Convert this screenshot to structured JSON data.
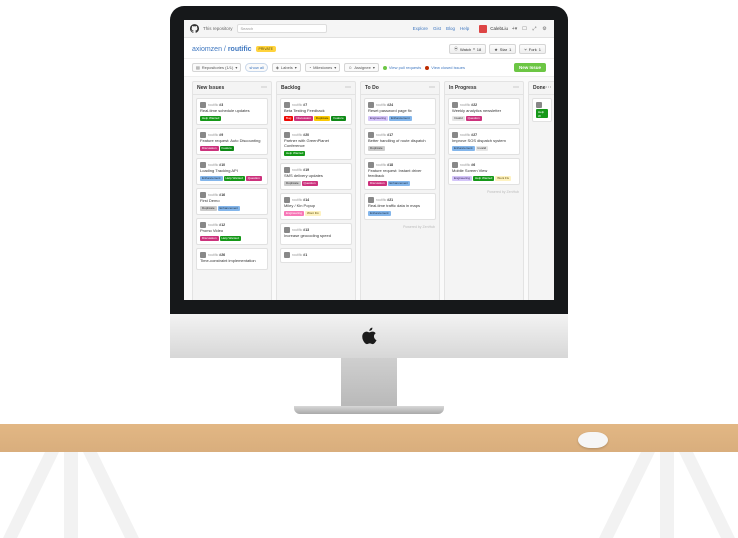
{
  "nav": {
    "context": "This repository",
    "search_placeholder": "Search",
    "links": [
      "Explore",
      "Gist",
      "Blog",
      "Help"
    ],
    "user": "CalebLiu",
    "icons": [
      "plus-icon",
      "notif-icon",
      "expand-icon",
      "gear-icon"
    ]
  },
  "repo": {
    "owner": "axiomzen",
    "name": "routific",
    "badge": "PRIVATE",
    "buttons": {
      "watch": "Watch",
      "star": "Star",
      "fork": "Fork",
      "watch_n": "18",
      "star_n": "1",
      "fork_n": "1"
    }
  },
  "filters": {
    "repos": "Repositories (1/1)",
    "show": "show all",
    "labels": "Labels",
    "milestones": "Milestones",
    "assignee": "Assignee",
    "open": "View pull requests",
    "closed": "View closed issues",
    "new_issue": "New Issue"
  },
  "board": {
    "columns": [
      {
        "title": "New Issues",
        "cards": [
          {
            "ref_repo": "routific",
            "ref_num": "#3",
            "title": "Real-time schedule updates",
            "labels": [
              "Help Wanted"
            ],
            "lcls": [
              "l-help"
            ]
          },
          {
            "ref_repo": "routific",
            "ref_num": "#9",
            "title": "Feature request: Auto Discounting",
            "labels": [
              "Discussion",
              "Feature"
            ],
            "lcls": [
              "l-disc",
              "l-feat"
            ]
          },
          {
            "ref_repo": "routific",
            "ref_num": "#10",
            "title": "Loading Tracking API",
            "labels": [
              "Enhancement",
              "Help Wanted",
              "Question"
            ],
            "lcls": [
              "l-enh",
              "l-help",
              "l-ques"
            ]
          },
          {
            "ref_repo": "routific",
            "ref_num": "#16",
            "title": "First Demo",
            "labels": [
              "Duplicate",
              "Enhancement"
            ],
            "lcls": [
              "l-dup",
              "l-enh"
            ]
          },
          {
            "ref_repo": "routific",
            "ref_num": "#12",
            "title": "Promo Video",
            "labels": [
              "Discussion",
              "Help Wanted"
            ],
            "lcls": [
              "l-disc",
              "l-help"
            ]
          },
          {
            "ref_repo": "routific",
            "ref_num": "#26",
            "title": "Time-constraint implementation",
            "labels": [],
            "lcls": []
          }
        ]
      },
      {
        "title": "Backlog",
        "cards": [
          {
            "ref_repo": "routific",
            "ref_num": "#7",
            "title": "Beta Testing Feedback",
            "labels": [
              "Bug",
              "Discussion",
              "Duplicate",
              "Feature"
            ],
            "lcls": [
              "l-bug",
              "l-disc",
              "l-dupo",
              "l-feat"
            ]
          },
          {
            "ref_repo": "routific",
            "ref_num": "#20",
            "title": "Partner with GreenPlanet Conference",
            "labels": [
              "Help Wanted"
            ],
            "lcls": [
              "l-help"
            ]
          },
          {
            "ref_repo": "routific",
            "ref_num": "#19",
            "title": "SMS delivery updates",
            "labels": [
              "Duplicate",
              "Question"
            ],
            "lcls": [
              "l-dup",
              "l-ques"
            ]
          },
          {
            "ref_repo": "routific",
            "ref_num": "#14",
            "title": "Miley / Kin Popup",
            "labels": [
              "Engineering",
              "Wont Fix"
            ],
            "lcls": [
              "l-pink",
              "l-wont"
            ]
          },
          {
            "ref_repo": "routific",
            "ref_num": "#13",
            "title": "Increase geocoding speed",
            "labels": [],
            "lcls": []
          },
          {
            "ref_repo": "routific",
            "ref_num": "#1",
            "title": "",
            "labels": [],
            "lcls": []
          }
        ]
      },
      {
        "title": "To Do",
        "cards": [
          {
            "ref_repo": "routific",
            "ref_num": "#24",
            "title": "Reset password page fix",
            "labels": [
              "Engineering",
              "Enhancement"
            ],
            "lcls": [
              "l-eng",
              "l-enh"
            ]
          },
          {
            "ref_repo": "routific",
            "ref_num": "#17",
            "title": "Better handling of route dispatch",
            "labels": [
              "Duplicate"
            ],
            "lcls": [
              "l-dup"
            ]
          },
          {
            "ref_repo": "routific",
            "ref_num": "#18",
            "title": "Feature request: Instant driver feedback",
            "labels": [
              "Discussion",
              "Enhancement"
            ],
            "lcls": [
              "l-disc",
              "l-enh"
            ]
          },
          {
            "ref_repo": "routific",
            "ref_num": "#21",
            "title": "Real-time traffic data in maps",
            "labels": [
              "Enhancement"
            ],
            "lcls": [
              "l-enh"
            ]
          }
        ],
        "powered": "ZenHub"
      },
      {
        "title": "In Progress",
        "cards": [
          {
            "ref_repo": "routific",
            "ref_num": "#22",
            "title": "Weekly analytics newsletter",
            "labels": [
              "Invalid",
              "Question"
            ],
            "lcls": [
              "l-inv",
              "l-ques"
            ]
          },
          {
            "ref_repo": "routific",
            "ref_num": "#27",
            "title": "Improve SOS dispatch system",
            "labels": [
              "Enhancement",
              "Invalid"
            ],
            "lcls": [
              "l-enh",
              "l-inv"
            ]
          },
          {
            "ref_repo": "routific",
            "ref_num": "#6",
            "title": "Mobile Screen View",
            "labels": [
              "Engineering",
              "Help Wanted",
              "Wont Fix"
            ],
            "lcls": [
              "l-eng",
              "l-help",
              "l-wont"
            ]
          }
        ],
        "powered": "ZenHub"
      },
      {
        "title": "Done",
        "narrow": true,
        "cards": [
          {
            "ref_repo": "",
            "ref_num": "",
            "title": "",
            "labels": [
              "Help W"
            ],
            "lcls": [
              "l-help"
            ]
          }
        ]
      }
    ]
  }
}
